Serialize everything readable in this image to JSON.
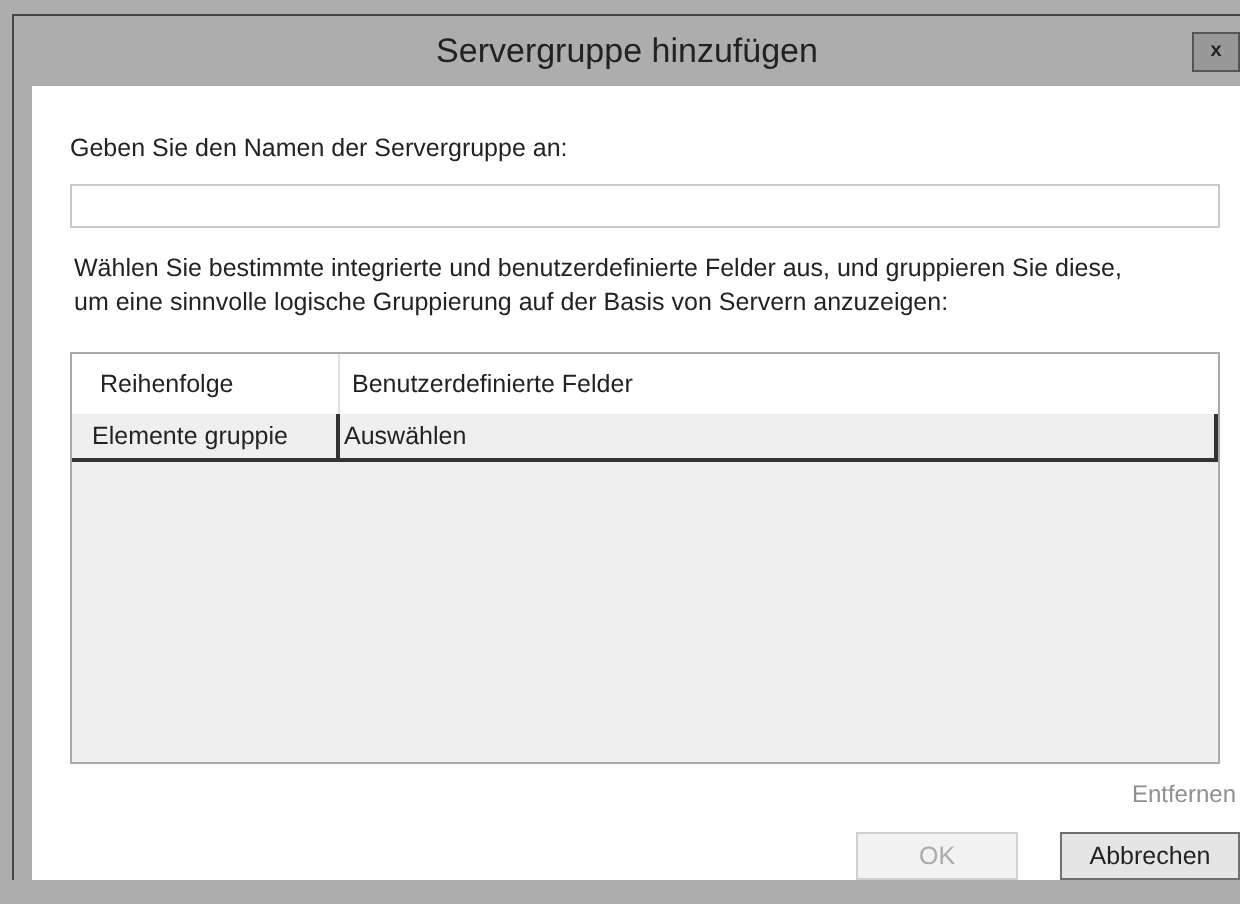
{
  "window": {
    "title": "Servergruppe hinzufügen",
    "close": "x"
  },
  "name_label": "Geben Sie den Namen der Servergruppe an:",
  "description": "Wählen Sie bestimmte integrierte und benutzerdefinierte Felder aus, und gruppieren Sie diese, um eine sinnvolle logische Gruppierung auf der Basis von Servern anzuzeigen:",
  "table": {
    "columns": [
      "Reihenfolge",
      "Benutzerdefinierte Felder"
    ],
    "rows": [
      {
        "cells": [
          "Elemente gruppie",
          "Auswählen"
        ],
        "selected": true
      }
    ]
  },
  "remove_button": {
    "label": "Entfernen",
    "disabled": true
  },
  "buttons": [
    {
      "label": "OK",
      "disabled": true
    },
    {
      "label": "Abbrechen",
      "disabled": false
    }
  ]
}
